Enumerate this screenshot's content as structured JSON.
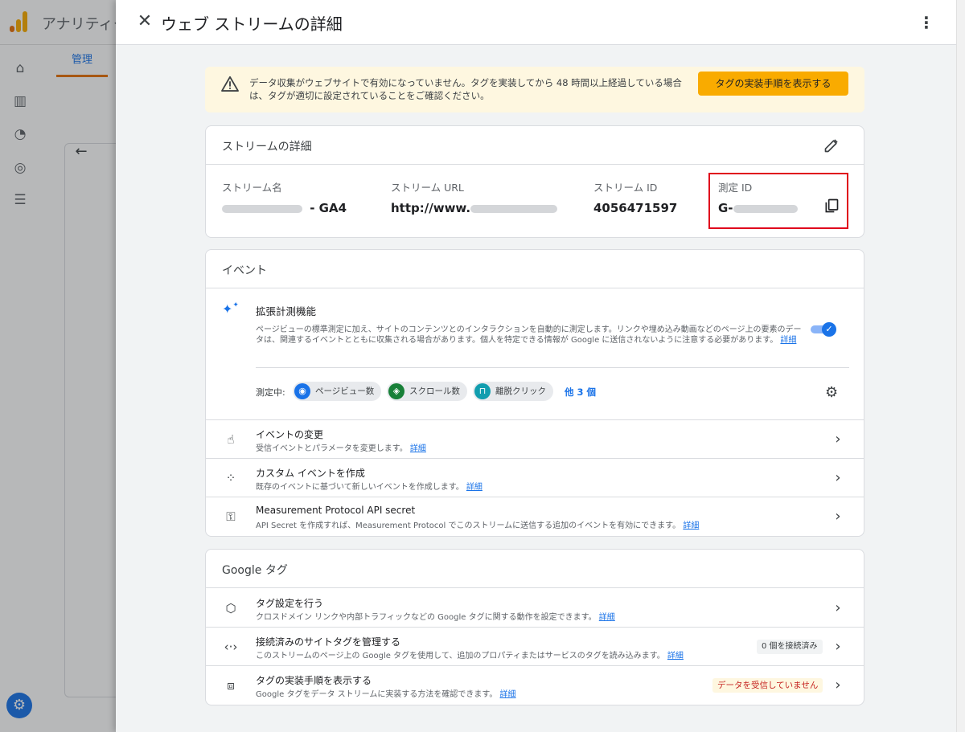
{
  "background": {
    "app_title": "アナリティクス",
    "tab_label": "管理"
  },
  "drawer": {
    "title": "ウェブ ストリームの詳細",
    "close_icon": "close-icon",
    "more_icon": "more-vert-icon"
  },
  "banner": {
    "text": "データ収集がウェブサイトで有効になっていません。タグを実装してから 48 時間以上経過している場合は、タグが適切に設定されていることをご確認ください。",
    "button": "タグの実装手順を表示する"
  },
  "stream_details": {
    "title": "ストリームの詳細",
    "fields": [
      {
        "label": "ストリーム名",
        "value_suffix": " - GA4"
      },
      {
        "label": "ストリーム URL",
        "value_prefix": "http://www."
      },
      {
        "label": "ストリーム ID",
        "value": "4056471597"
      },
      {
        "label": "測定 ID",
        "value_prefix": "G-"
      }
    ]
  },
  "events": {
    "title": "イベント",
    "enhanced": {
      "title": "拡張計測機能",
      "description": "ページビューの標準測定に加え、サイトのコンテンツとのインタラクションを自動的に測定します。リンクや埋め込み動画などのページ上の要素のデータは、関連するイベントとともに収集される場合があります。個人を特定できる情報が Google に送信されないように注意する必要があります。",
      "link": "詳細",
      "enabled": true,
      "measuring_label": "測定中:",
      "chips": [
        {
          "label": "ページビュー数",
          "icon": "eye-icon",
          "color": "#1a73e8"
        },
        {
          "label": "スクロール数",
          "icon": "scroll-icon",
          "color": "#188038"
        },
        {
          "label": "離脱クリック",
          "icon": "lock-icon",
          "color": "#129eaf"
        }
      ],
      "more": "他 3 個"
    },
    "rows": [
      {
        "title": "イベントの変更",
        "sub": "受信イベントとパラメータを変更します。",
        "link": "詳細"
      },
      {
        "title": "カスタム イベントを作成",
        "sub": "既存のイベントに基づいて新しいイベントを作成します。",
        "link": "詳細"
      },
      {
        "title": "Measurement Protocol API secret",
        "sub": "API Secret を作成すれば、Measurement Protocol でこのストリームに送信する追加のイベントを有効にできます。",
        "link": "詳細"
      }
    ]
  },
  "google_tag": {
    "title": "Google タグ",
    "rows": [
      {
        "title": "タグ設定を行う",
        "sub": "クロスドメイン リンクや内部トラフィックなどの Google タグに関する動作を設定できます。",
        "link": "詳細"
      },
      {
        "title": "接続済みのサイトタグを管理する",
        "sub": "このストリームのページ上の Google タグを使用して、追加のプロパティまたはサービスのタグを読み込みます。",
        "link": "詳細",
        "badge": "0 個を接続済み"
      },
      {
        "title": "タグの実装手順を表示する",
        "sub": "Google タグをデータ ストリームに実装する方法を確認できます。",
        "link": "詳細",
        "badge": "データを受信していません"
      }
    ]
  },
  "colors": {
    "accent": "#1a73e8",
    "warning_bg": "#fef7e0",
    "warning_button": "#f9ab00",
    "highlight": "#e0001b"
  }
}
